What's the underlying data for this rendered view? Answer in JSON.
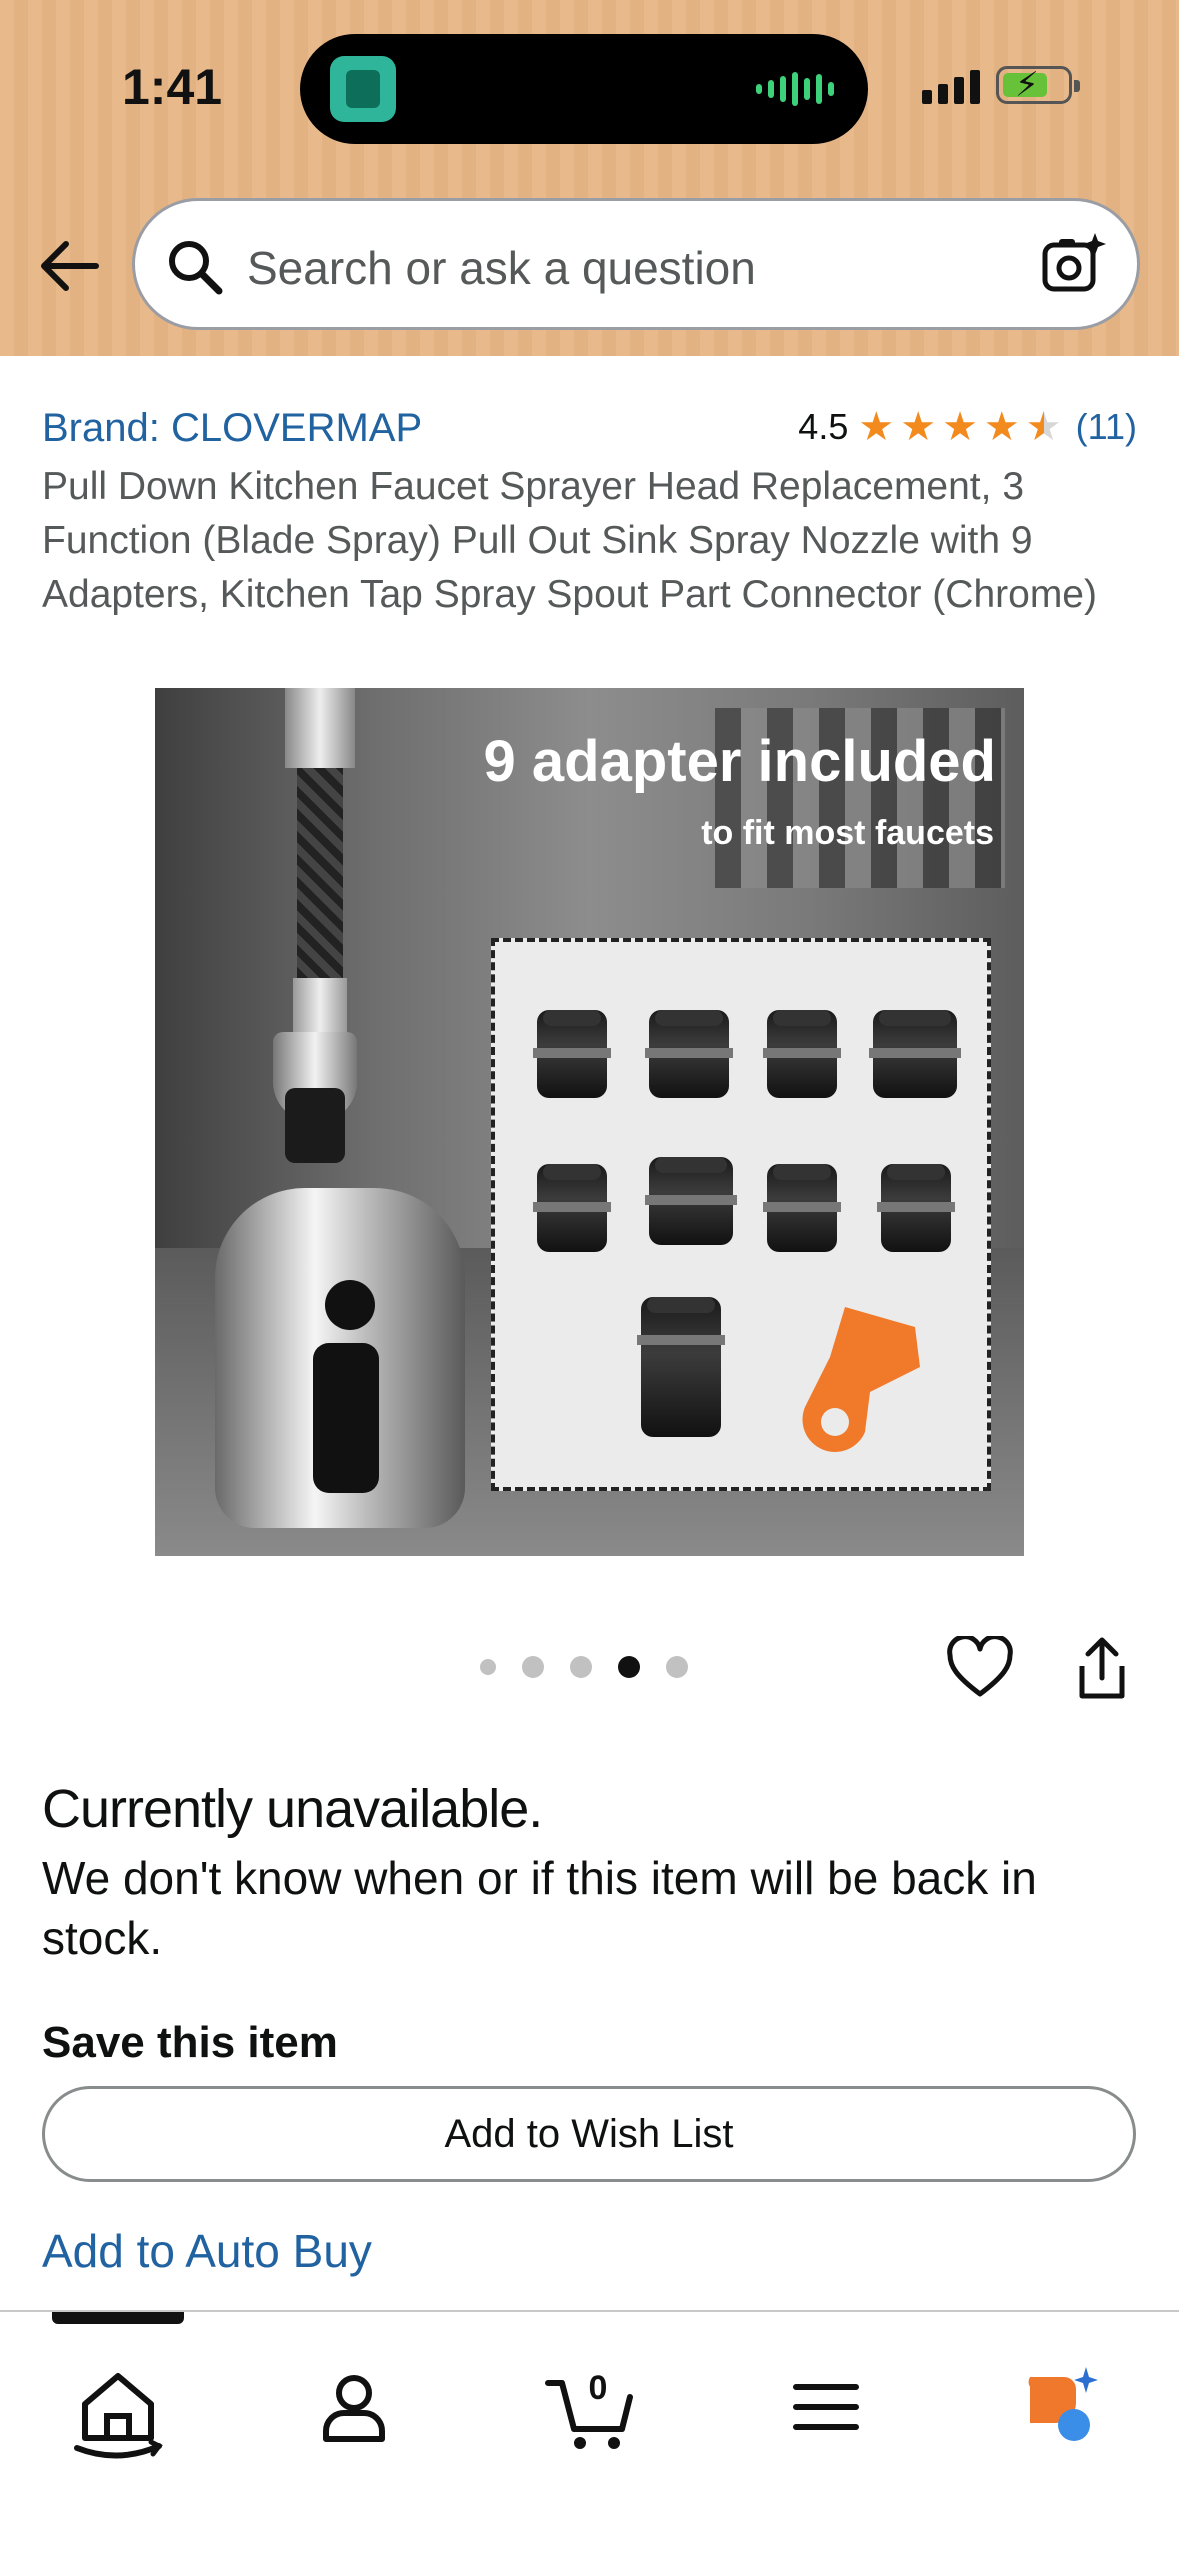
{
  "status_bar": {
    "time": "1:41"
  },
  "search": {
    "placeholder": "Search or ask a question"
  },
  "product": {
    "brand": "Brand: CLOVERMAP",
    "rating": "4.5",
    "stars": 4.5,
    "review_count": "(11)",
    "title": "Pull Down Kitchen Faucet Sprayer Head Replacement, 3 Function (Blade Spray) Pull Out Sink Spray Nozzle with 9 Adapters, Kitchen Tap Spray Spout Part Connector (Chrome)",
    "image": {
      "headline": "9 adapter included",
      "subline": "to fit most faucets"
    }
  },
  "carousel": {
    "count": 5,
    "active_index": 3
  },
  "availability": {
    "heading": "Currently unavailable.",
    "message": "We don't know when or if this item will be back in stock."
  },
  "save": {
    "heading": "Save this item",
    "wish_list_button": "Add to Wish List",
    "auto_buy_link": "Add to Auto Buy"
  },
  "tab_bar": {
    "cart_count": "0",
    "items": [
      "home-icon",
      "account-icon",
      "cart-icon",
      "menu-icon",
      "rufus-icon"
    ],
    "active": "home-icon"
  },
  "colors": {
    "header_bg": "#e8b98a",
    "link": "#2162a1",
    "star": "#f28a1e",
    "rufus_orange": "#f0782d",
    "rufus_blue": "#3b8ee8"
  }
}
